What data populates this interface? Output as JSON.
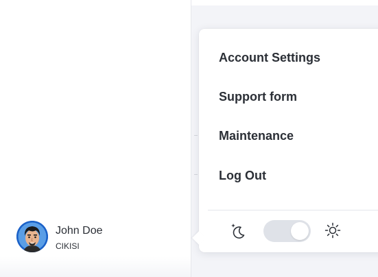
{
  "menu": {
    "items": [
      {
        "label": "Account Settings"
      },
      {
        "label": "Support form"
      },
      {
        "label": "Maintenance"
      },
      {
        "label": "Log Out"
      }
    ]
  },
  "theme_switch": {
    "left_icon": "moon-icon",
    "right_icon": "sun-icon",
    "selected": "light"
  },
  "user": {
    "name": "John Doe",
    "organization": "CIKISI",
    "avatar_icon": "avatar-portrait"
  },
  "colors": {
    "menu_text": "#2b2f36",
    "avatar_ring": "#1a61c8",
    "toggle_track": "#dfe2e8",
    "main_background": "#f3f4f8"
  }
}
